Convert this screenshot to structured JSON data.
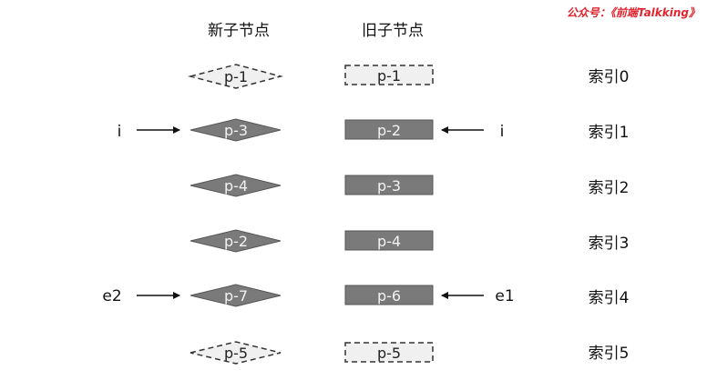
{
  "watermark": "公众号：《前端Talkking》",
  "headers": {
    "new_children": "新子节点",
    "old_children": "旧子节点"
  },
  "new_children": [
    {
      "label": "p-1",
      "style": "dashed"
    },
    {
      "label": "p-3",
      "style": "solid"
    },
    {
      "label": "p-4",
      "style": "solid"
    },
    {
      "label": "p-2",
      "style": "solid"
    },
    {
      "label": "p-7",
      "style": "solid"
    },
    {
      "label": "p-5",
      "style": "dashed"
    }
  ],
  "old_children": [
    {
      "label": "p-1",
      "style": "dashed"
    },
    {
      "label": "p-2",
      "style": "solid"
    },
    {
      "label": "p-3",
      "style": "solid"
    },
    {
      "label": "p-4",
      "style": "solid"
    },
    {
      "label": "p-6",
      "style": "solid"
    },
    {
      "label": "p-5",
      "style": "dashed"
    }
  ],
  "indices": [
    "索引0",
    "索引1",
    "索引2",
    "索引3",
    "索引4",
    "索引5"
  ],
  "pointers": {
    "left_i": "i",
    "right_i": "i",
    "left_e2": "e2",
    "right_e1": "e1"
  },
  "colors": {
    "solid_fill": "#7a7a7a",
    "dashed_fill": "#f0f0f0",
    "stroke": "#333333",
    "arrow": "#111111",
    "watermark": "#e0242f"
  }
}
